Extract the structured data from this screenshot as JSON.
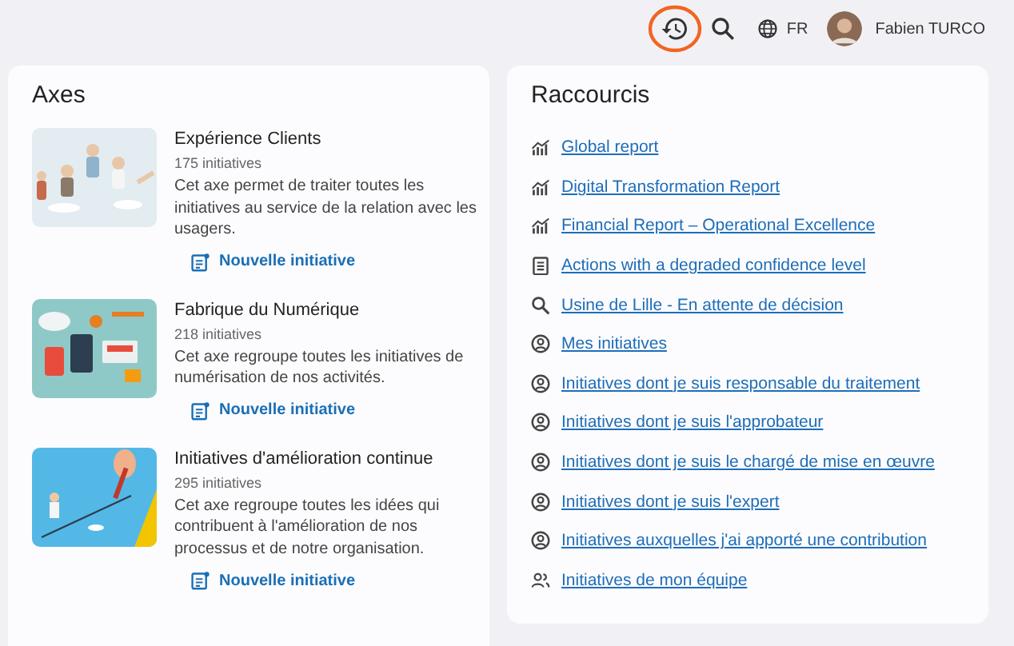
{
  "topbar": {
    "language": "FR",
    "user": "Fabien TURCO",
    "history_highlighted": true
  },
  "axes": {
    "title": "Axes",
    "items": [
      {
        "title": "Expérience Clients",
        "count": "175 initiatives",
        "description": "Cet axe permet de traiter toutes les initiatives au service de la relation avec les usagers.",
        "action": "Nouvelle initiative"
      },
      {
        "title": "Fabrique du Numérique",
        "count": "218 initiatives",
        "description": "Cet axe regroupe toutes les initiatives de numérisation de nos activités.",
        "action": "Nouvelle initiative"
      },
      {
        "title": "Initiatives d'amélioration continue",
        "count": "295 initiatives",
        "description": "Cet axe regroupe toutes les idées qui contribuent à l'amélioration de nos processus et de notre organisation.",
        "action": "Nouvelle initiative"
      }
    ]
  },
  "shortcuts": {
    "title": "Raccourcis",
    "items": [
      {
        "kind": "report",
        "label": "Global report"
      },
      {
        "kind": "report",
        "label": "Digital Transformation Report"
      },
      {
        "kind": "report",
        "label": "Financial Report – Operational Excellence"
      },
      {
        "kind": "list",
        "label": "Actions with a degraded confidence level"
      },
      {
        "kind": "search",
        "label": "Usine de Lille - En attente de décision"
      },
      {
        "kind": "person",
        "label": "Mes initiatives"
      },
      {
        "kind": "person",
        "label": "Initiatives dont je suis responsable du traitement"
      },
      {
        "kind": "person",
        "label": "Initiatives dont je suis l'approbateur"
      },
      {
        "kind": "person",
        "label": "Initiatives dont je suis le chargé de mise en œuvre"
      },
      {
        "kind": "person",
        "label": "Initiatives dont je suis l'expert"
      },
      {
        "kind": "person",
        "label": "Initiatives auxquelles j'ai apporté une contribution"
      },
      {
        "kind": "team",
        "label": "Initiatives de mon équipe"
      }
    ]
  }
}
